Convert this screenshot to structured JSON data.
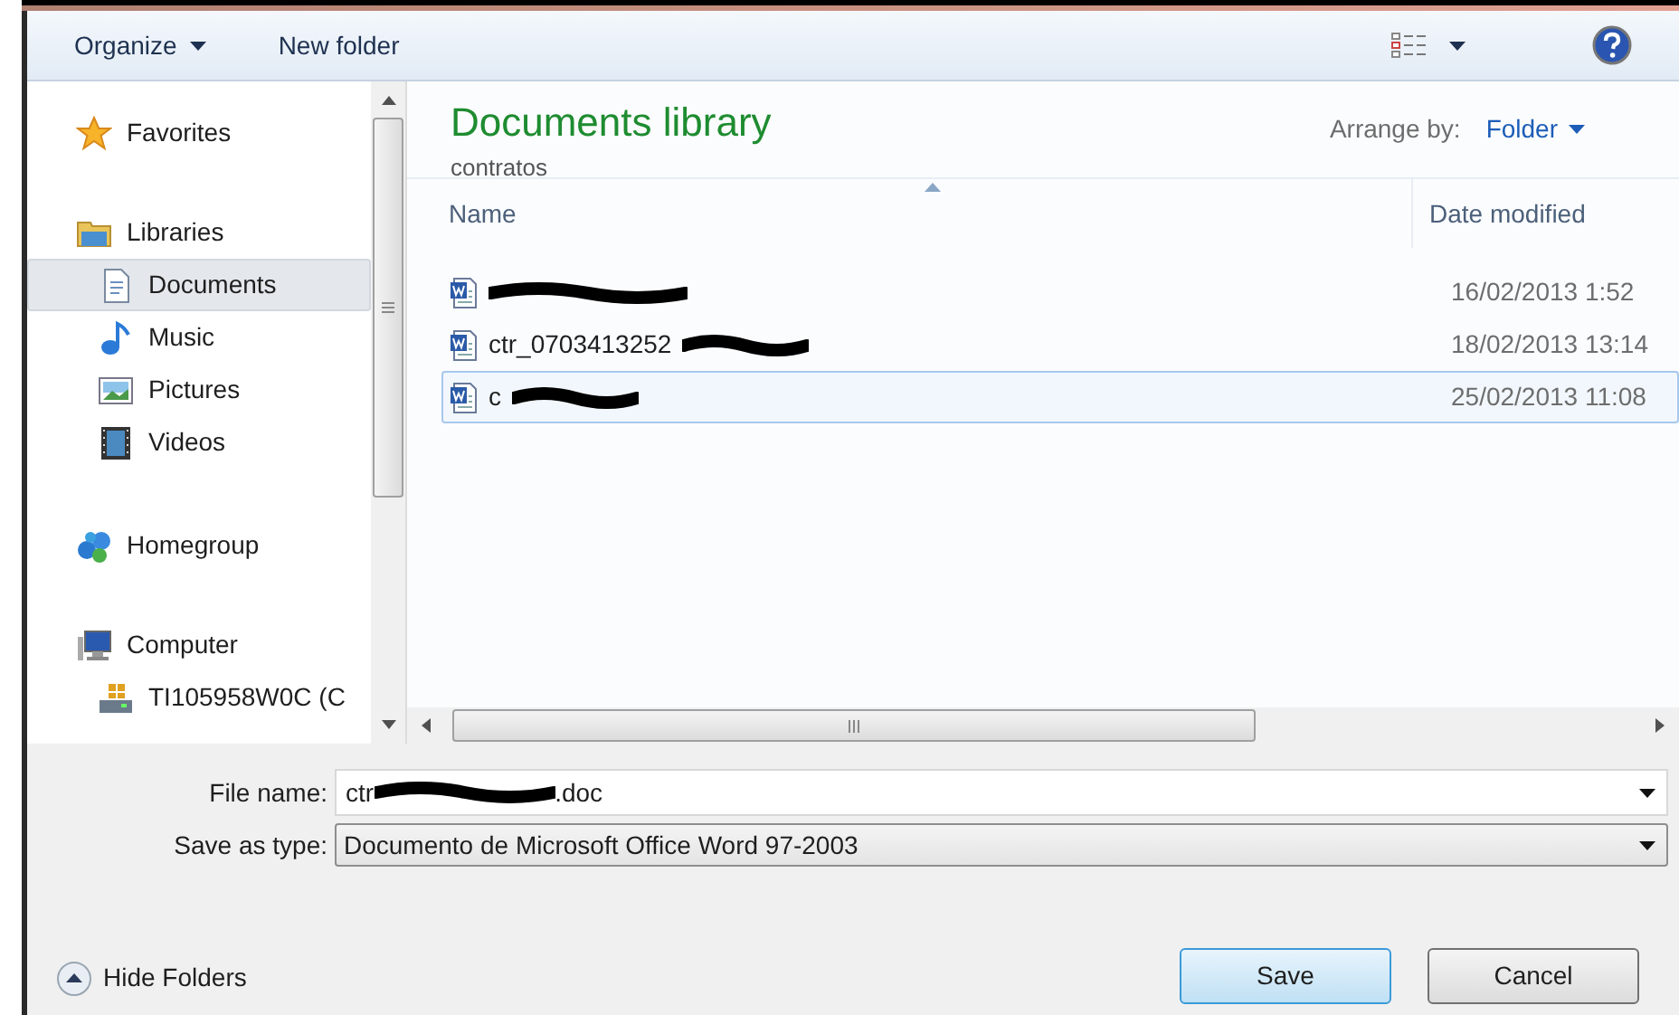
{
  "toolbar": {
    "organize": "Organize",
    "new_folder": "New folder"
  },
  "sidebar": {
    "items": [
      {
        "label": "Favorites",
        "kind": "star",
        "selected": false
      },
      {
        "label": "Libraries",
        "kind": "library",
        "selected": false,
        "children": [
          {
            "label": "Documents",
            "kind": "document",
            "selected": true
          },
          {
            "label": "Music",
            "kind": "music",
            "selected": false
          },
          {
            "label": "Pictures",
            "kind": "pictures",
            "selected": false
          },
          {
            "label": "Videos",
            "kind": "videos",
            "selected": false
          }
        ]
      },
      {
        "label": "Homegroup",
        "kind": "homegroup",
        "selected": false
      },
      {
        "label": "Computer",
        "kind": "computer",
        "selected": false,
        "children": [
          {
            "label": "TI105958W0C (C",
            "kind": "drive",
            "selected": false
          }
        ]
      }
    ]
  },
  "library": {
    "title": "Documents library",
    "subtitle": "contratos",
    "arrange_label": "Arrange by:",
    "arrange_value": "Folder"
  },
  "table": {
    "columns": [
      "Name",
      "Date modified"
    ],
    "rows": [
      {
        "redacted": true,
        "date": "16/02/2013 1:52",
        "selected": false
      },
      {
        "name": "ctr_0703413252",
        "redacted": true,
        "date": "18/02/2013 13:14",
        "selected": false
      },
      {
        "name": "c",
        "redacted": true,
        "date": "25/02/2013 11:08",
        "selected": true
      }
    ]
  },
  "file_name": {
    "label": "File name:",
    "value_start": "ctr",
    "redacted": true,
    "value_end": ".doc"
  },
  "save_as_type": {
    "label": "Save as type:",
    "value": "Documento de Microsoft Office Word 97-2003"
  },
  "hide_folders": "Hide Folders",
  "buttons": [
    {
      "label": "Save",
      "kind": "default"
    },
    {
      "label": "Cancel",
      "kind": "normal"
    }
  ]
}
